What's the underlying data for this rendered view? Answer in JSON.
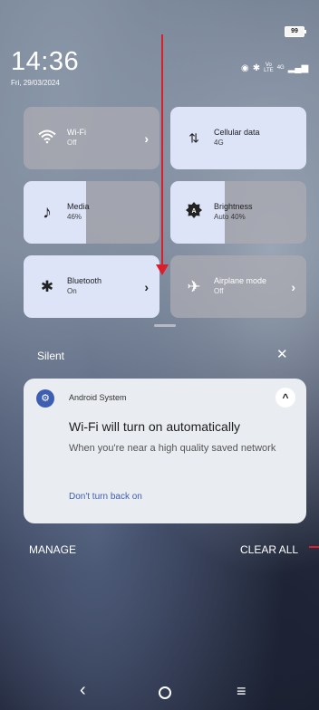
{
  "status_bar": {
    "battery": "99",
    "time": "14:36",
    "date": "Fri, 29/03/2024",
    "icons": [
      "nfc-icon",
      "bluetooth-icon",
      "volte-icon",
      "4g-icon",
      "signal-icon"
    ],
    "volte_text": "Vo\nLTE",
    "net_text": "4G"
  },
  "tiles": [
    {
      "label": "Wi-Fi",
      "sub": "Off",
      "icon": "wifi-icon",
      "state": "off",
      "chevron": "›"
    },
    {
      "label": "Cellular data",
      "sub": "4G",
      "icon": "cellular-data-icon",
      "state": "on"
    },
    {
      "label": "Media",
      "sub": "46%",
      "icon": "music-note-icon",
      "level": 0.46
    },
    {
      "label": "Brightness",
      "sub": "Auto 40%",
      "icon": "brightness-icon",
      "level": 0.4
    },
    {
      "label": "Bluetooth",
      "sub": "On",
      "icon": "bluetooth-icon",
      "state": "on",
      "chevron": "›"
    },
    {
      "label": "Airplane mode",
      "sub": "Off",
      "icon": "airplane-icon",
      "state": "off",
      "chevron": "›"
    }
  ],
  "notifications": {
    "section_title": "Silent",
    "close_label": "✕",
    "card": {
      "app_name": "Android System",
      "title": "Wi-Fi will turn on automatically",
      "body": "When you're near a high quality saved network",
      "action": "Don't turn back on",
      "expand_glyph": "^"
    }
  },
  "actions": {
    "manage": "MANAGE",
    "clear_all": "CLEAR ALL"
  },
  "nav": {
    "back": "‹",
    "menu": "≡"
  },
  "colors": {
    "accent": "#3e5fb1",
    "annotation": "#d81f2b",
    "tile_active": "#dde4f8"
  }
}
